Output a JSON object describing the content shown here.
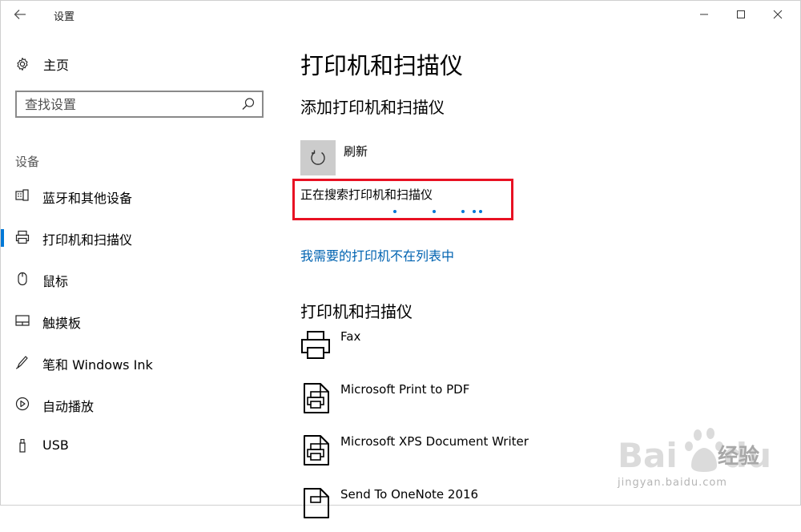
{
  "window": {
    "title": "设置"
  },
  "sidebar": {
    "home": "主页",
    "search": {
      "placeholder": "查找设置",
      "value": ""
    },
    "section": "设备",
    "items": [
      {
        "label": "蓝牙和其他设备",
        "icon": "bluetooth-device-icon"
      },
      {
        "label": "打印机和扫描仪",
        "icon": "printer-icon",
        "active": true
      },
      {
        "label": "鼠标",
        "icon": "mouse-icon"
      },
      {
        "label": "触摸板",
        "icon": "touchpad-icon"
      },
      {
        "label": "笔和 Windows Ink",
        "icon": "pen-icon"
      },
      {
        "label": "自动播放",
        "icon": "autoplay-icon"
      },
      {
        "label": "USB",
        "icon": "usb-icon"
      }
    ]
  },
  "main": {
    "title": "打印机和扫描仪",
    "add_section": {
      "heading": "添加打印机和扫描仪",
      "refresh_label": "刷新",
      "searching_text": "正在搜索打印机和扫描仪",
      "missing_link": "我需要的打印机不在列表中"
    },
    "list_section": {
      "heading": "打印机和扫描仪",
      "printers": [
        {
          "name": "Fax",
          "icon": "fax-icon"
        },
        {
          "name": "Microsoft Print to PDF",
          "icon": "pdf-printer-icon"
        },
        {
          "name": "Microsoft XPS Document Writer",
          "icon": "xps-printer-icon"
        },
        {
          "name": "Send To OneNote 2016",
          "icon": "onenote-printer-icon"
        }
      ]
    }
  },
  "watermark": {
    "brand": "Bai du 经验",
    "url": "jingyan.baidu.com"
  },
  "colors": {
    "accent": "#0078d7",
    "link": "#0063b1",
    "highlight": "#e81123",
    "tile": "#cccccc"
  }
}
